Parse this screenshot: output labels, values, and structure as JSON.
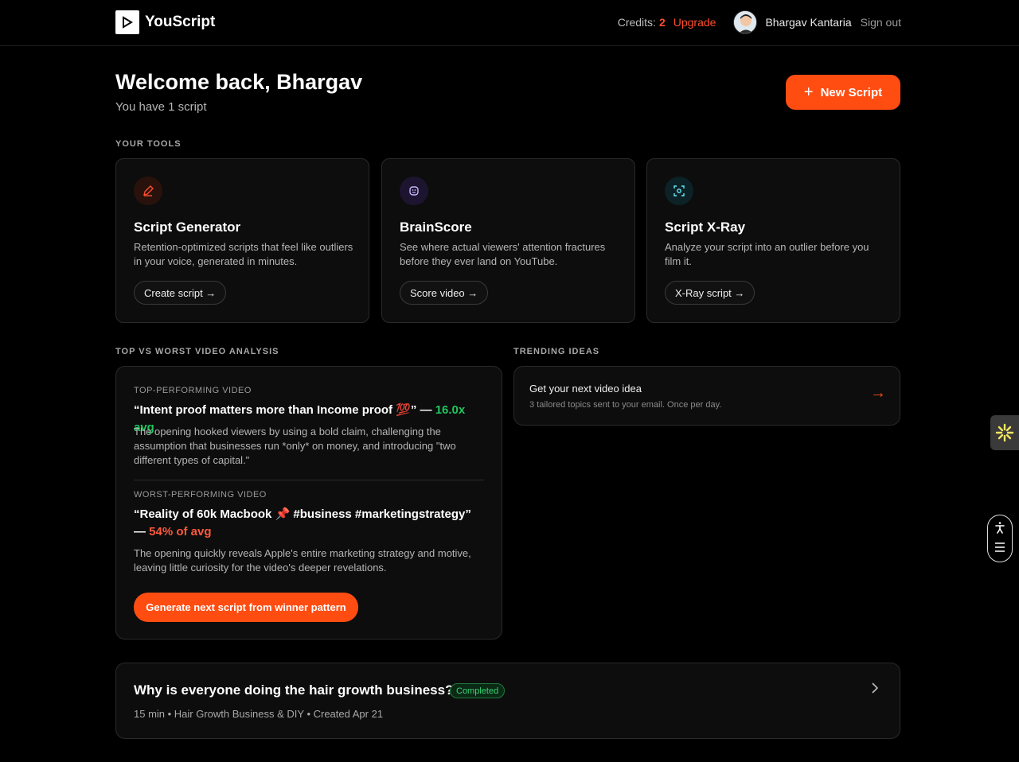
{
  "header": {
    "brand": "YouScript",
    "credits_label": "Credits:",
    "credits_value": "2",
    "upgrade": "Upgrade",
    "user_name": "Bhargav Kantaria",
    "sign_out": "Sign out"
  },
  "main": {
    "welcome": "Welcome back, Bhargav",
    "subtitle": "You have 1 script",
    "new_script": "New Script"
  },
  "tools": {
    "label": "YOUR TOOLS",
    "items": [
      {
        "title": "Script Generator",
        "desc": "Retention-optimized scripts that feel like outliers in your voice, generated in minutes.",
        "button": "Create script →",
        "icon": "pencil-icon",
        "color": "#ff4d2d"
      },
      {
        "title": "BrainScore",
        "desc": "See where actual viewers' attention fractures before they ever land on YouTube.",
        "button": "Score video →",
        "icon": "brain-icon",
        "color": "#c4b5fd"
      },
      {
        "title": "Script X-Ray",
        "desc": "Analyze your script into an outlier before you film it.",
        "button": "X-Ray script →",
        "icon": "scan-icon",
        "color": "#67e8f9"
      }
    ]
  },
  "analysis": {
    "label": "TOP VS WORST VIDEO ANALYSIS",
    "top_label": "TOP-PERFORMING VIDEO",
    "top_title": "“Intent proof matters more than Income proof 💯” — ",
    "top_metric": "16.0x avg",
    "top_desc": "The opening hooked viewers by using a bold claim, challenging the assumption that businesses run *only* on money, and introducing \"two different types of capital.\"",
    "worst_label": "WORST-PERFORMING VIDEO",
    "worst_title": "“Reality of 60k Macbook 📌 #business #marketingstrategy” — ",
    "worst_metric": "54% of avg",
    "worst_desc": "The opening quickly reveals Apple's entire marketing strategy and motive, leaving little curiosity for the video's deeper revelations.",
    "cta": "Generate next script from winner pattern"
  },
  "trending": {
    "label": "TRENDING IDEAS",
    "title": "Get your next video idea",
    "subtitle": "3 tailored topics sent to your email. Once per day.",
    "arrow": "→"
  },
  "scripts": [
    {
      "title": "Why is everyone doing the hair growth business?",
      "status": "Completed",
      "meta": "15 min • Hair Growth Business & DIY • Created Apr 21"
    }
  ],
  "colors": {
    "accent": "#ff4d12",
    "success": "#22c55e",
    "danger": "#ff5a3c"
  }
}
